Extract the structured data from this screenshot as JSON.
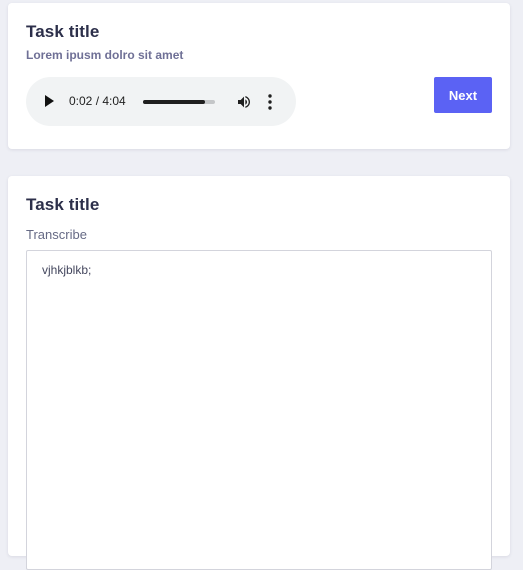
{
  "top_card": {
    "title": "Task title",
    "subtitle": "Lorem ipusm dolro sit amet",
    "audio": {
      "time": "0:02 / 4:04",
      "progress_fraction": 0.86
    },
    "next_label": "Next"
  },
  "bottom_card": {
    "title": "Task title",
    "field_label": "Transcribe",
    "textarea_value": "vjhkjblkb;"
  },
  "colors": {
    "page_background": "#eeeff5",
    "card_background": "#ffffff",
    "accent_button": "#5b62f4",
    "title_text": "#2c2f4a",
    "subtitle_text": "#6f7096",
    "audio_player_background": "#f1f3f4"
  },
  "icons": {
    "play": "play-icon",
    "volume": "volume-icon",
    "more": "more-vertical-icon"
  }
}
